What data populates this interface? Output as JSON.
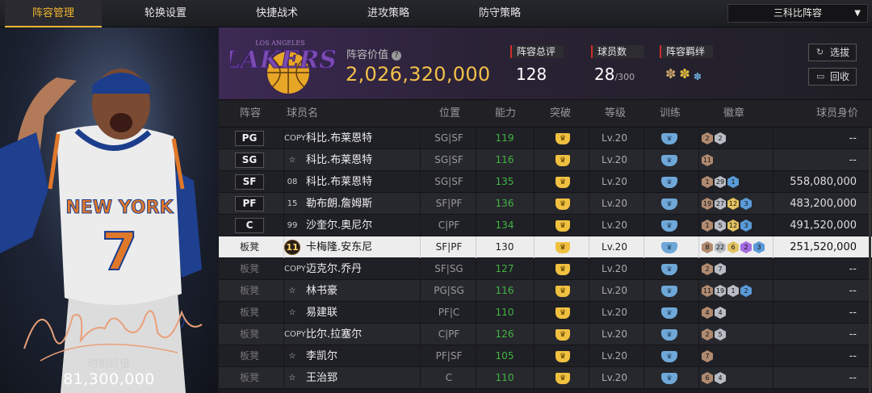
{
  "nav": {
    "tabs": [
      {
        "label": "阵容管理",
        "active": true
      },
      {
        "label": "轮换设置",
        "active": false
      },
      {
        "label": "快捷战术",
        "active": false
      },
      {
        "label": "进攻策略",
        "active": false
      },
      {
        "label": "防守策略",
        "active": false
      }
    ],
    "lineup_dropdown": "三科比阵容"
  },
  "featured": {
    "moment_value_label": "时刻价值",
    "moment_value": "81,300,000",
    "jersey_team": "NEW YORK",
    "jersey_number": "7",
    "jersey_number_small": "7"
  },
  "header": {
    "team_logo": "LAKERS",
    "team_logo_sub": "LOS ANGELES",
    "team_value_label": "阵容价值",
    "team_value": "2,026,320,000",
    "rating_label": "阵容总评",
    "rating": "128",
    "player_count_label": "球员数",
    "player_count": "28",
    "player_count_max": "/300",
    "chemistry_label": "阵容羁绊",
    "select_button": "选拔",
    "recycle_button": "回收"
  },
  "table": {
    "columns": [
      "阵容",
      "球员名",
      "位置",
      "能力",
      "突破",
      "等级",
      "训练",
      "徽章",
      "球员身价"
    ],
    "rows": [
      {
        "slot": "PG",
        "bench": false,
        "card": "COPY",
        "name": "科比.布莱恩特",
        "pos": "SG|SF",
        "ability": "119",
        "level": "Lv.20",
        "badges": [
          {
            "t": "bronze",
            "n": "2"
          },
          {
            "t": "silver",
            "n": "2"
          }
        ],
        "value": "--"
      },
      {
        "slot": "SG",
        "bench": false,
        "card": "☆",
        "name": "科比.布莱恩特",
        "pos": "SG|SF",
        "ability": "116",
        "level": "Lv.20",
        "badges": [
          {
            "t": "bronze",
            "n": "11"
          }
        ],
        "value": "--"
      },
      {
        "slot": "SF",
        "bench": false,
        "card": "08",
        "name": "科比.布莱恩特",
        "pos": "SG|SF",
        "ability": "135",
        "level": "Lv.20",
        "badges": [
          {
            "t": "bronze",
            "n": "1"
          },
          {
            "t": "silver",
            "n": "29"
          },
          {
            "t": "blue",
            "n": "1"
          }
        ],
        "value": "558,080,000"
      },
      {
        "slot": "PF",
        "bench": false,
        "card": "15",
        "name": "勒布朗.詹姆斯",
        "pos": "SF|PF",
        "ability": "136",
        "level": "Lv.20",
        "badges": [
          {
            "t": "bronze",
            "n": "19"
          },
          {
            "t": "silver",
            "n": "27"
          },
          {
            "t": "gold",
            "n": "12"
          },
          {
            "t": "blue",
            "n": "3"
          }
        ],
        "value": "483,200,000"
      },
      {
        "slot": "C",
        "bench": false,
        "card": "99",
        "name": "沙奎尔.奥尼尔",
        "pos": "C|PF",
        "ability": "134",
        "level": "Lv.20",
        "badges": [
          {
            "t": "bronze",
            "n": "1"
          },
          {
            "t": "silver",
            "n": "5"
          },
          {
            "t": "gold",
            "n": "12"
          },
          {
            "t": "blue",
            "n": "3"
          }
        ],
        "value": "491,520,000"
      },
      {
        "slot": "板凳",
        "bench": true,
        "card": "11",
        "name": "卡梅隆.安东尼",
        "pos": "SF|PF",
        "ability": "130",
        "level": "Lv.20",
        "badges": [
          {
            "t": "bronze",
            "n": "8"
          },
          {
            "t": "silver",
            "n": "22"
          },
          {
            "t": "gold",
            "n": "6"
          },
          {
            "t": "purple",
            "n": "2"
          },
          {
            "t": "blue",
            "n": "3"
          }
        ],
        "value": "251,520,000",
        "selected": true
      },
      {
        "slot": "板凳",
        "bench": true,
        "card": "COPY",
        "name": "迈克尔.乔丹",
        "pos": "SF|SG",
        "ability": "127",
        "level": "Lv.20",
        "badges": [
          {
            "t": "bronze",
            "n": "2"
          },
          {
            "t": "silver",
            "n": "7"
          }
        ],
        "value": "--"
      },
      {
        "slot": "板凳",
        "bench": true,
        "card": "☆",
        "name": "林书豪",
        "pos": "PG|SG",
        "ability": "116",
        "level": "Lv.20",
        "badges": [
          {
            "t": "bronze",
            "n": "11"
          },
          {
            "t": "silver",
            "n": "19"
          },
          {
            "t": "silver",
            "n": "1"
          },
          {
            "t": "blue",
            "n": "2"
          }
        ],
        "value": "--"
      },
      {
        "slot": "板凳",
        "bench": true,
        "card": "☆",
        "name": "易建联",
        "pos": "PF|C",
        "ability": "110",
        "level": "Lv.20",
        "badges": [
          {
            "t": "bronze",
            "n": "4"
          },
          {
            "t": "silver",
            "n": "4"
          }
        ],
        "value": "--"
      },
      {
        "slot": "板凳",
        "bench": true,
        "card": "COPY",
        "name": "比尔.拉塞尔",
        "pos": "C|PF",
        "ability": "126",
        "level": "Lv.20",
        "badges": [
          {
            "t": "bronze",
            "n": "2"
          },
          {
            "t": "silver",
            "n": "5"
          }
        ],
        "value": "--"
      },
      {
        "slot": "板凳",
        "bench": true,
        "card": "☆",
        "name": "李凯尔",
        "pos": "PF|SF",
        "ability": "105",
        "level": "Lv.20",
        "badges": [
          {
            "t": "bronze",
            "n": "7"
          }
        ],
        "value": "--"
      },
      {
        "slot": "板凳",
        "bench": true,
        "card": "☆",
        "name": "王治郅",
        "pos": "C",
        "ability": "110",
        "level": "Lv.20",
        "badges": [
          {
            "t": "bronze",
            "n": "6"
          },
          {
            "t": "silver",
            "n": "4"
          }
        ],
        "value": "--"
      }
    ]
  },
  "colors": {
    "accent": "#f0b530",
    "ability_green": "#43b443",
    "badge_bronze": "#b08a70",
    "badge_silver": "#b9bcc4",
    "badge_gold": "#e2c261",
    "badge_purple": "#a46ce0",
    "badge_blue": "#5a9ad8"
  }
}
